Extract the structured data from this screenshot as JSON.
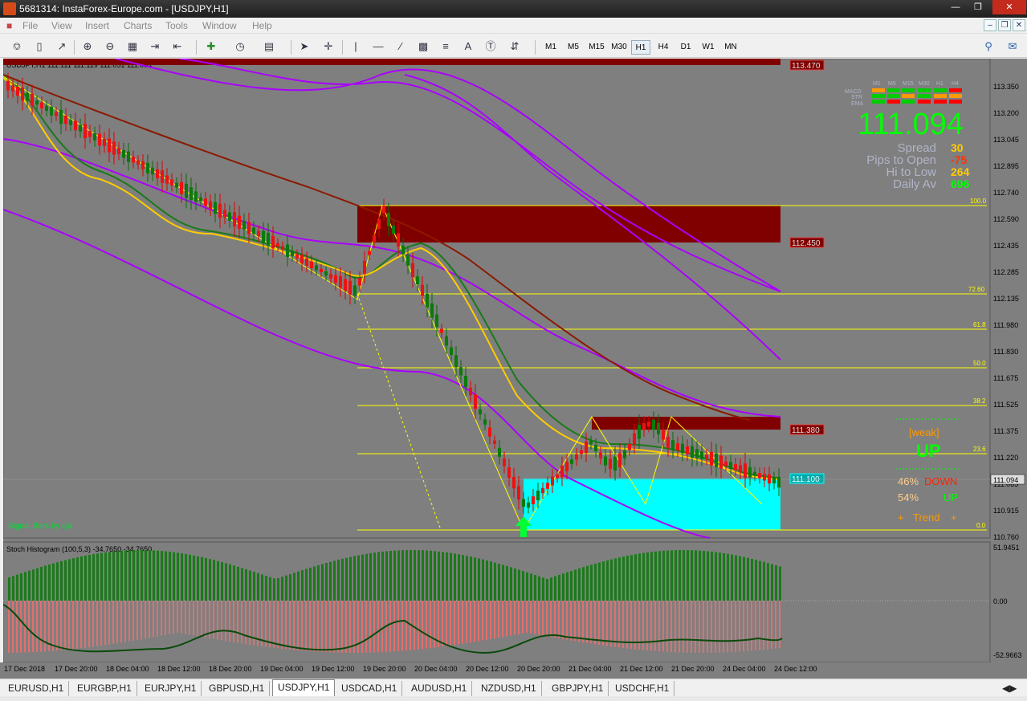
{
  "window": {
    "title": "5681314: InstaForex-Europe.com - [USDJPY,H1]"
  },
  "menu": [
    "File",
    "View",
    "Insert",
    "Charts",
    "Tools",
    "Window",
    "Help"
  ],
  "timeframes": [
    "M1",
    "M5",
    "M15",
    "M30",
    "H1",
    "H4",
    "D1",
    "W1",
    "MN"
  ],
  "active_timeframe": "H1",
  "chart": {
    "header": "USDJPY,H1  111.111 111.119 111.051 111.094",
    "signal_label": "Signal Bars by cja",
    "price_scale": [
      "113.350",
      "113.200",
      "113.045",
      "112.895",
      "112.740",
      "112.590",
      "112.435",
      "112.285",
      "112.135",
      "111.980",
      "111.830",
      "111.675",
      "111.525",
      "111.375",
      "111.220",
      "111.065",
      "110.915",
      "110.760"
    ],
    "time_scale": [
      "17 Dec 2018",
      "17 Dec 20:00",
      "18 Dec 04:00",
      "18 Dec 12:00",
      "18 Dec 20:00",
      "19 Dec 04:00",
      "19 Dec 12:00",
      "19 Dec 20:00",
      "20 Dec 04:00",
      "20 Dec 12:00",
      "20 Dec 20:00",
      "21 Dec 04:00",
      "21 Dec 12:00",
      "21 Dec 20:00",
      "24 Dec 04:00",
      "24 Dec 12:00"
    ],
    "price_boxes": {
      "top": "113.470",
      "zone1": "112.450",
      "zone2": "111.380",
      "zone3": "111.100",
      "current": "111.094"
    },
    "fibo_levels": [
      "100.0",
      "72.60",
      "61.8",
      "50.0",
      "38.2",
      "23.6",
      "0.0"
    ],
    "info_panel": {
      "tf_headers": [
        "M1",
        "M5",
        "M15",
        "M30",
        "H1",
        "H4"
      ],
      "row_labels": [
        "MACD",
        "STR",
        "EMA"
      ],
      "price": "111.094",
      "rows": [
        {
          "label": "Spread",
          "value": "30"
        },
        {
          "label": "Pips to Open",
          "value": "-75"
        },
        {
          "label": "Hi to Low",
          "value": "264"
        },
        {
          "label": "Daily Av",
          "value": "696"
        }
      ],
      "colors": {
        "green": "#00ff00",
        "red": "#ff0000",
        "orange": "#ff9900",
        "gray_text": "#b0b4c8"
      }
    },
    "trend_panel": {
      "strength": "[weak]",
      "direction": "UP",
      "down_pct": "46%",
      "down_label": "DOWN",
      "up_pct": "54%",
      "up_label": "UP",
      "trend_label": "Trend"
    }
  },
  "histogram": {
    "header": "Stoch Histogram (100,5,3) -34.7650 -34.7650",
    "scale": [
      "51.9451",
      "0.00",
      "-52.9663"
    ]
  },
  "tabs": [
    "EURUSD,H1",
    "EURGBP,H1",
    "EURJPY,H1",
    "GBPUSD,H1",
    "USDJPY,H1",
    "USDCAD,H1",
    "AUDUSD,H1",
    "NZDUSD,H1",
    "GBPJPY,H1",
    "USDCHF,H1"
  ],
  "active_tab": "USDJPY,H1"
}
